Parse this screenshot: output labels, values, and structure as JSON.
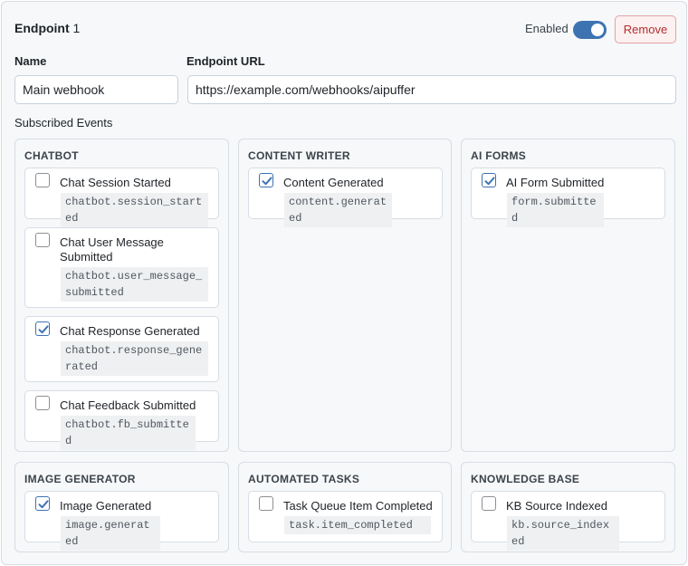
{
  "header": {
    "title_bold": "Endpoint",
    "title_number": "1",
    "enabled_label": "Enabled",
    "enabled": true,
    "remove_label": "Remove"
  },
  "fields": {
    "name_label": "Name",
    "name_value": "Main webhook",
    "url_label": "Endpoint URL",
    "url_value": "https://example.com/webhooks/aipuffer"
  },
  "subscribed_label": "Subscribed Events",
  "groups": [
    {
      "title": "CHATBOT",
      "events": [
        {
          "label": "Chat Session Started",
          "code": "chatbot.session_started",
          "checked": false
        },
        {
          "label": "Chat User Message Submitted",
          "code": "chatbot.user_message_submitted",
          "checked": false
        },
        {
          "label": "Chat Response Generated",
          "code": "chatbot.response_generated",
          "checked": true
        },
        {
          "label": "Chat Feedback Submitted",
          "code": "chatbot.fb_submitted",
          "checked": false
        }
      ]
    },
    {
      "title": "CONTENT WRITER",
      "events": [
        {
          "label": "Content Generated",
          "code": "content.generated",
          "checked": true
        }
      ]
    },
    {
      "title": "AI FORMS",
      "events": [
        {
          "label": "AI Form Submitted",
          "code": "form.submitted",
          "checked": true
        }
      ]
    },
    {
      "title": "IMAGE GENERATOR",
      "events": [
        {
          "label": "Image Generated",
          "code": "image.generated",
          "checked": true
        }
      ]
    },
    {
      "title": "AUTOMATED TASKS",
      "events": [
        {
          "label": "Task Queue Item Completed",
          "code": "task.item_completed",
          "checked": false
        }
      ]
    },
    {
      "title": "KNOWLEDGE BASE",
      "events": [
        {
          "label": "KB Source Indexed",
          "code": "kb.source_indexed",
          "checked": false
        }
      ]
    }
  ],
  "colors": {
    "accent": "#3d73b1",
    "danger": "#b32d2e"
  }
}
